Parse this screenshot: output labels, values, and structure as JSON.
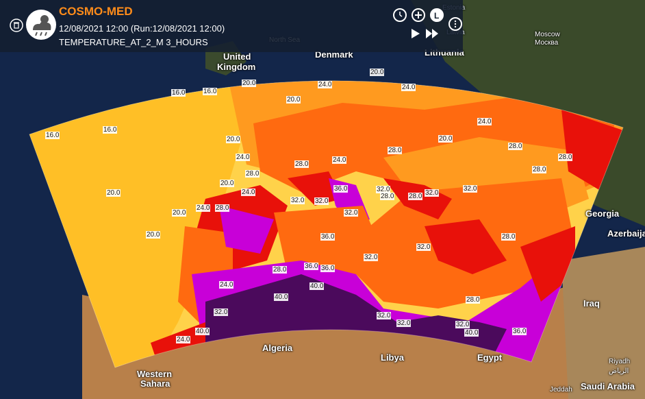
{
  "header": {
    "title": "COSMO-MED",
    "datetime": "12/08/2021 12:00 (Run:12/08/2021 12:00)",
    "layer": "TEMPERATURE_AT_2_M 3_HOURS"
  },
  "controls": {
    "icons": [
      "clock-icon",
      "zoom-in-icon",
      "legend-icon",
      "info-icon",
      "play-icon",
      "fast-forward-icon",
      "trash-icon",
      "weather-logo-icon"
    ]
  },
  "colors": {
    "t16": "#ffd24a",
    "t20": "#ffbf26",
    "t24": "#ff9a1f",
    "t28": "#ff6a10",
    "t32": "#e8110a",
    "t36": "#c800d8",
    "t40": "#4b0a5c",
    "accent": "#ff8c1a"
  },
  "map_labels": [
    {
      "text": "Estonia",
      "cls": "dim"
    },
    {
      "text": "Latvia",
      "cls": "dim"
    },
    {
      "text": "Lithuania",
      "cls": ""
    },
    {
      "text": "Moscow",
      "cls": "small"
    },
    {
      "text": "Москва",
      "cls": "small"
    },
    {
      "text": "North Sea",
      "cls": "dim"
    },
    {
      "text": "United",
      "cls": ""
    },
    {
      "text": "Kingdom",
      "cls": ""
    },
    {
      "text": "Denmark",
      "cls": ""
    },
    {
      "text": "Georgia",
      "cls": ""
    },
    {
      "text": "Azerbaija",
      "cls": ""
    },
    {
      "text": "Iraq",
      "cls": ""
    },
    {
      "text": "Algeria",
      "cls": ""
    },
    {
      "text": "Libya",
      "cls": ""
    },
    {
      "text": "Egypt",
      "cls": ""
    },
    {
      "text": "Western",
      "cls": ""
    },
    {
      "text": "Sahara",
      "cls": ""
    },
    {
      "text": "Riyadh",
      "cls": "small"
    },
    {
      "text": "الرياض",
      "cls": "small"
    },
    {
      "text": "Saudi Arabia",
      "cls": ""
    },
    {
      "text": "Jeddah",
      "cls": "small"
    }
  ],
  "contour_labels": [
    "16.0",
    "16.0",
    "16.0",
    "16.0",
    "20.0",
    "20.0",
    "20.0",
    "20.0",
    "20.0",
    "20.0",
    "20.0",
    "20.0",
    "20.0",
    "24.0",
    "24.0",
    "24.0",
    "24.0",
    "24.0",
    "24.0",
    "24.0",
    "24.0",
    "24.0",
    "28.0",
    "28.0",
    "28.0",
    "28.0",
    "28.0",
    "28.0",
    "28.0",
    "28.0",
    "28.0",
    "28.0",
    "28.0",
    "28.0",
    "32.0",
    "32.0",
    "32.0",
    "32.0",
    "32.0",
    "32.0",
    "32.0",
    "32.0",
    "32.0",
    "32.0",
    "32.0",
    "32.0",
    "36.0",
    "36.0",
    "36.0",
    "36.0",
    "36.0",
    "40.0",
    "40.0",
    "40.0",
    "40.0"
  ]
}
